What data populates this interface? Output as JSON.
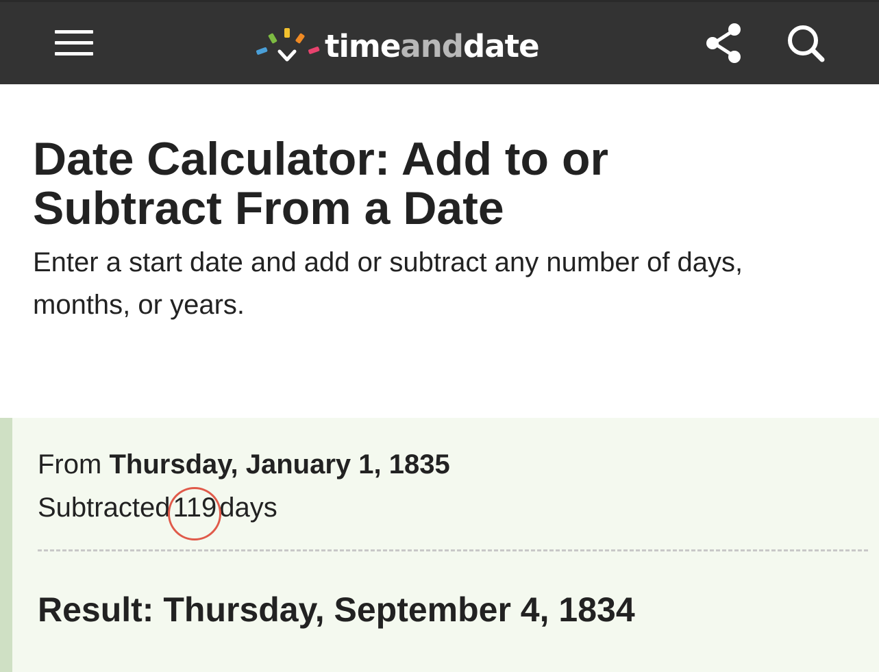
{
  "header": {
    "brand_part1": "time",
    "brand_part2": "and",
    "brand_part3": "date",
    "background_color": "#333333",
    "icons": {
      "menu": "hamburger-menu-icon",
      "share": "share-icon",
      "search": "search-icon"
    }
  },
  "page": {
    "title": "Date Calculator: Add to or Subtract From a Date",
    "subtitle": "Enter a start date and add or subtract any number of days, months, or years."
  },
  "result": {
    "from_label": "From",
    "from_date": "Thursday, January 1, 1835",
    "operation_label": "Subtracted",
    "amount": "119",
    "unit": "days",
    "result_label": "Result:",
    "result_date": "Thursday, September 4, 1834",
    "background_color": "#f4f9ef",
    "accent_color": "#cfe0c4",
    "annotation_color": "#e05a4a"
  }
}
